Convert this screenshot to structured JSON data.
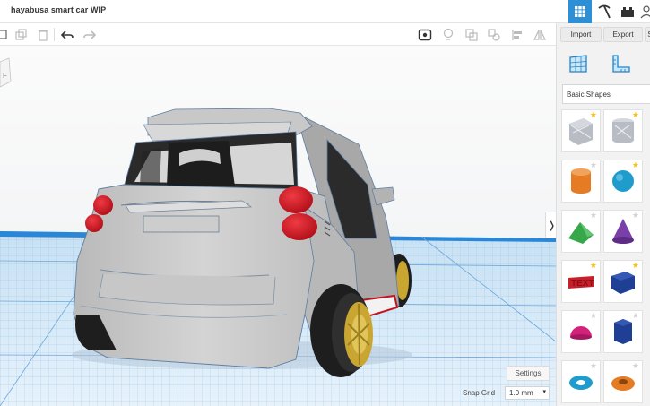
{
  "app": {
    "title": "hayabusa smart car WIP"
  },
  "viewControls": [
    "grid-view-icon",
    "pickaxe-icon",
    "bricks-icon",
    "user-icon"
  ],
  "toolbar": {
    "left": [
      "copy-icon",
      "duplicate-icon",
      "delete-icon",
      "undo-icon",
      "redo-icon"
    ],
    "right": [
      "note-icon",
      "light-icon",
      "group-icon",
      "ungroup-icon",
      "align-icon",
      "mirror-icon"
    ]
  },
  "panel": {
    "import_label": "Import",
    "export_label": "Export",
    "category_label": "Basic Shapes",
    "shapes": [
      {
        "name": "box-hole",
        "color": "#b8bcc4",
        "starred": true
      },
      {
        "name": "cylinder-hole",
        "color": "#b8bcc4",
        "starred": true
      },
      {
        "name": "cylinder",
        "color": "#e57c23",
        "starred": false
      },
      {
        "name": "sphere",
        "color": "#1e9ccc",
        "starred": true
      },
      {
        "name": "roof",
        "color": "#37a84a",
        "starred": false
      },
      {
        "name": "cone",
        "color": "#7a3fa8",
        "starred": false
      },
      {
        "name": "text",
        "color": "#c8202a",
        "starred": true
      },
      {
        "name": "box",
        "color": "#1f3f94",
        "starred": true
      },
      {
        "name": "half-sphere",
        "color": "#d2237a",
        "starred": false
      },
      {
        "name": "polygon",
        "color": "#1f3f94",
        "starred": false
      },
      {
        "name": "torus",
        "color": "#1e9ccc",
        "starred": false
      },
      {
        "name": "tube",
        "color": "#e57c23",
        "starred": false
      }
    ]
  },
  "viewport": {
    "settings_label": "Settings",
    "snap_label": "Snap Grid",
    "snap_value": "1.0 mm",
    "colors": {
      "grid": "#2a86d6",
      "car_body": "#c4c4c4",
      "tail_lights": "#d3141e",
      "rims": "#c9a632",
      "tires": "#1e1e1e"
    }
  }
}
